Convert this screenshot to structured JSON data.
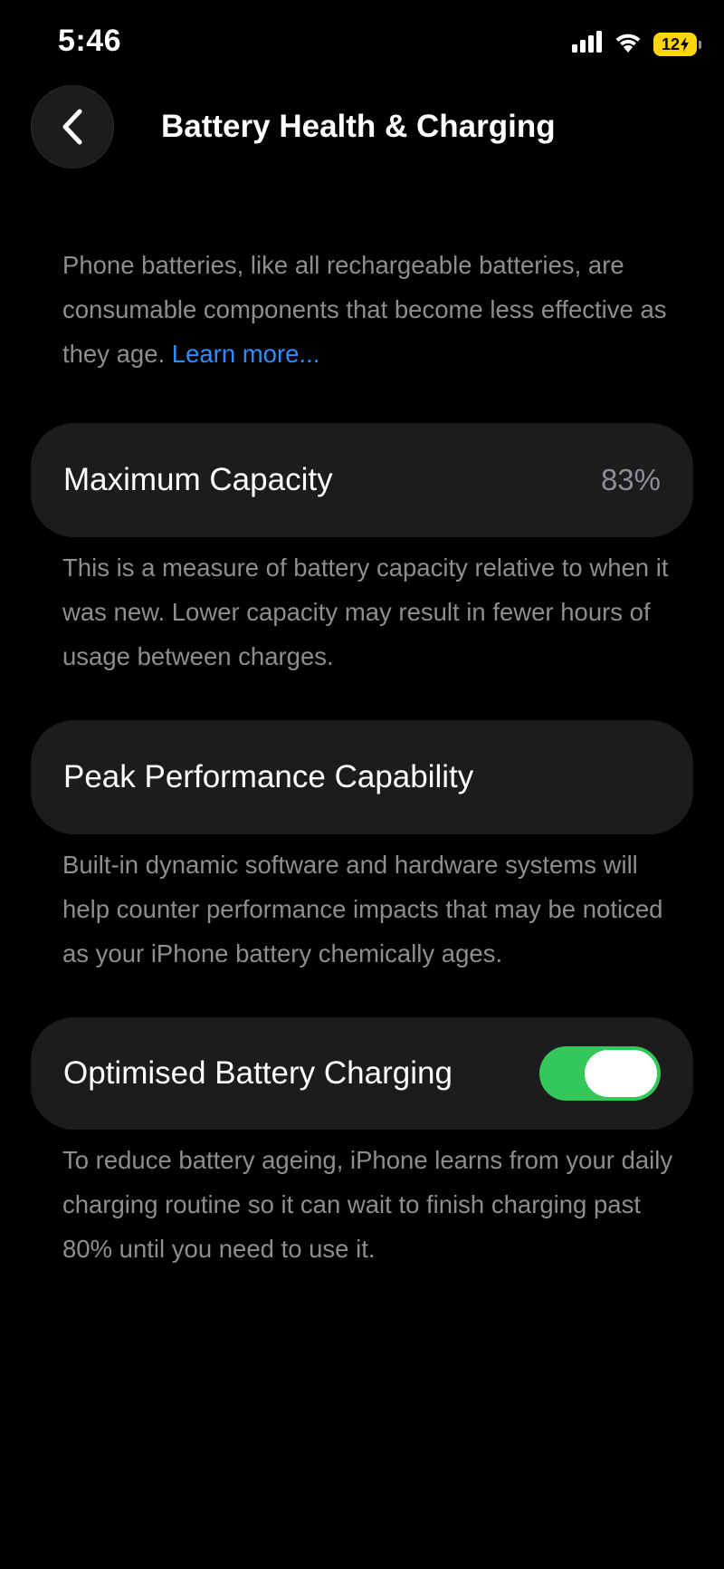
{
  "status_bar": {
    "time": "5:46",
    "battery_level": "12",
    "icons": [
      "cellular-signal-icon",
      "wifi-icon",
      "battery-charging-icon"
    ]
  },
  "nav": {
    "title": "Battery Health & Charging",
    "back_icon": "chevron-left-icon"
  },
  "intro": {
    "text": "Phone batteries, like all rechargeable batteries, are consumable components that become less effective as they age.",
    "link": "Learn more..."
  },
  "max_capacity": {
    "label": "Maximum Capacity",
    "value": "83%",
    "description": "This is a measure of battery capacity relative to when it was new. Lower capacity may result in fewer hours of usage between charges."
  },
  "peak_performance": {
    "label": "Peak Performance Capability",
    "description": "Built-in dynamic software and hardware systems will help counter performance impacts that may be noticed as your iPhone battery chemically ages."
  },
  "optimised_charging": {
    "label": "Optimised Battery Charging",
    "enabled": true,
    "description": "To reduce battery ageing, iPhone learns from your daily charging routine so it can wait to finish charging past 80% until you need to use it."
  },
  "colors": {
    "background": "#000000",
    "card": "#1c1c1e",
    "secondary_text": "#8d8d92",
    "link": "#2f8cff",
    "toggle_on": "#34c759",
    "battery_low_power": "#ffd60a"
  }
}
